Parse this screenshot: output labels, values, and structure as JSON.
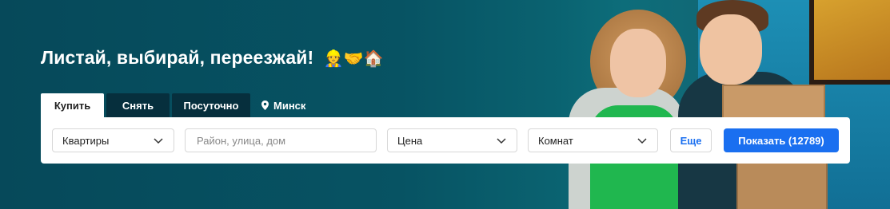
{
  "hero": {
    "headline": "Листай, выбирай, переезжай!",
    "emojis": "👷🤝🏠"
  },
  "tabs": [
    {
      "label": "Купить",
      "active": true
    },
    {
      "label": "Снять",
      "active": false
    },
    {
      "label": "Посуточно",
      "active": false
    }
  ],
  "location": {
    "label": "Минск",
    "icon": "location-pin-icon"
  },
  "search": {
    "property_type": "Квартиры",
    "address_placeholder": "Район, улица, дом",
    "price_label": "Цена",
    "rooms_label": "Комнат",
    "more_label": "Еще",
    "show_label": "Показать (12789)"
  },
  "colors": {
    "accent": "#1a6ff0",
    "background": "#075363",
    "tab_dark": "#062f3d"
  }
}
